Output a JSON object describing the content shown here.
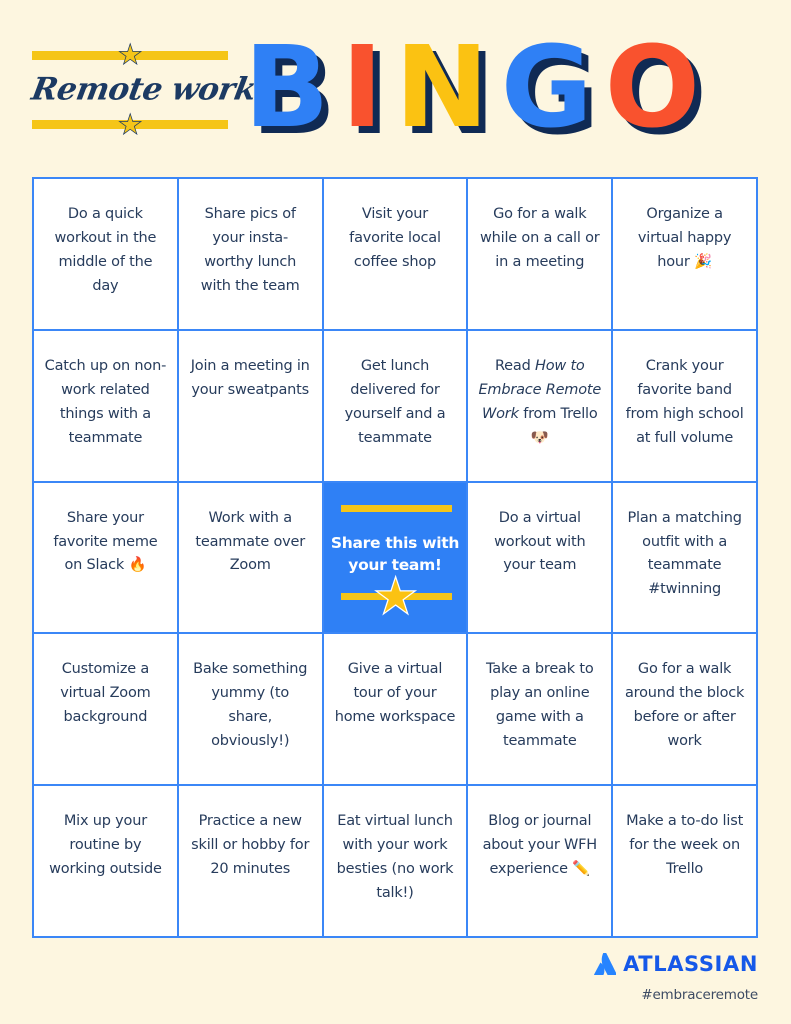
{
  "page": {
    "background_color": "#fdf6e0"
  },
  "header": {
    "script_title": "Remote work",
    "star_icon": "★",
    "bingo_letters": [
      {
        "char": "B",
        "color": "#2f80f5"
      },
      {
        "char": "I",
        "color": "#f9522e"
      },
      {
        "char": "N",
        "color": "#fbc212"
      },
      {
        "char": "G",
        "color": "#2f80f5"
      },
      {
        "char": "O",
        "color": "#f9522e"
      }
    ],
    "shadow_color": "#102a54"
  },
  "grid": {
    "border_color": "#3b87f7",
    "cell_background": "#ffffff",
    "text_color": "#273c5c",
    "rows": 5,
    "columns": 5,
    "cells": [
      {
        "text": "Do a quick workout in the middle of the day",
        "type": "task"
      },
      {
        "text": "Share pics of your insta-worthy lunch with the team",
        "type": "task"
      },
      {
        "text": "Visit your favorite local coffee shop",
        "type": "task"
      },
      {
        "text": "Go for a walk while on a call or in a meeting",
        "type": "task"
      },
      {
        "text": "Organize a virtual happy hour 🎉",
        "type": "task"
      },
      {
        "text": "Catch up on non-work related things with a teammate",
        "type": "task"
      },
      {
        "text": "Join a meeting in your sweatpants",
        "type": "task"
      },
      {
        "text": "Get lunch delivered for yourself and a teammate",
        "type": "task"
      },
      {
        "text": "Read How to Embrace Remote Work from Trello 🐶",
        "type": "task",
        "italic_part": "How to Embrace Remote Work",
        "html": "Read <i>How to Embrace Remote Work</i> from Trello 🐶"
      },
      {
        "text": "Crank your favorite band from high school at full volume",
        "type": "task"
      },
      {
        "text": "Share your favorite meme on Slack 🔥",
        "type": "task"
      },
      {
        "text": "Work with a teammate over Zoom",
        "type": "task"
      },
      {
        "text": "Share this with your team!",
        "type": "free-space",
        "background_color": "#2f80f5",
        "text_color": "#ffffff",
        "rule_color": "#f5c518",
        "star_icon": "★"
      },
      {
        "text": "Do a virtual workout with your team",
        "type": "task"
      },
      {
        "text": "Plan a matching outfit with a teammate #twinning",
        "type": "task"
      },
      {
        "text": "Customize a virtual Zoom background",
        "type": "task"
      },
      {
        "text": "Bake something yummy (to share, obviously!)",
        "type": "task"
      },
      {
        "text": "Give a virtual tour of your home workspace",
        "type": "task"
      },
      {
        "text": "Take a break to play an online game with a teammate",
        "type": "task"
      },
      {
        "text": "Go for a walk around the block before or after work",
        "type": "task"
      },
      {
        "text": "Mix up your routine by working outside",
        "type": "task"
      },
      {
        "text": "Practice a new skill or hobby for 20 minutes",
        "type": "task"
      },
      {
        "text": "Eat virtual lunch with your work besties (no work talk!)",
        "type": "task"
      },
      {
        "text": "Blog or journal about your WFH experience ✏️",
        "type": "task"
      },
      {
        "text": "Make a to-do list for the week on Trello",
        "type": "task"
      }
    ]
  },
  "footer": {
    "brand_name": "ATLASSIAN",
    "brand_color": "#1558e8",
    "hashtag": "#embraceremote"
  }
}
